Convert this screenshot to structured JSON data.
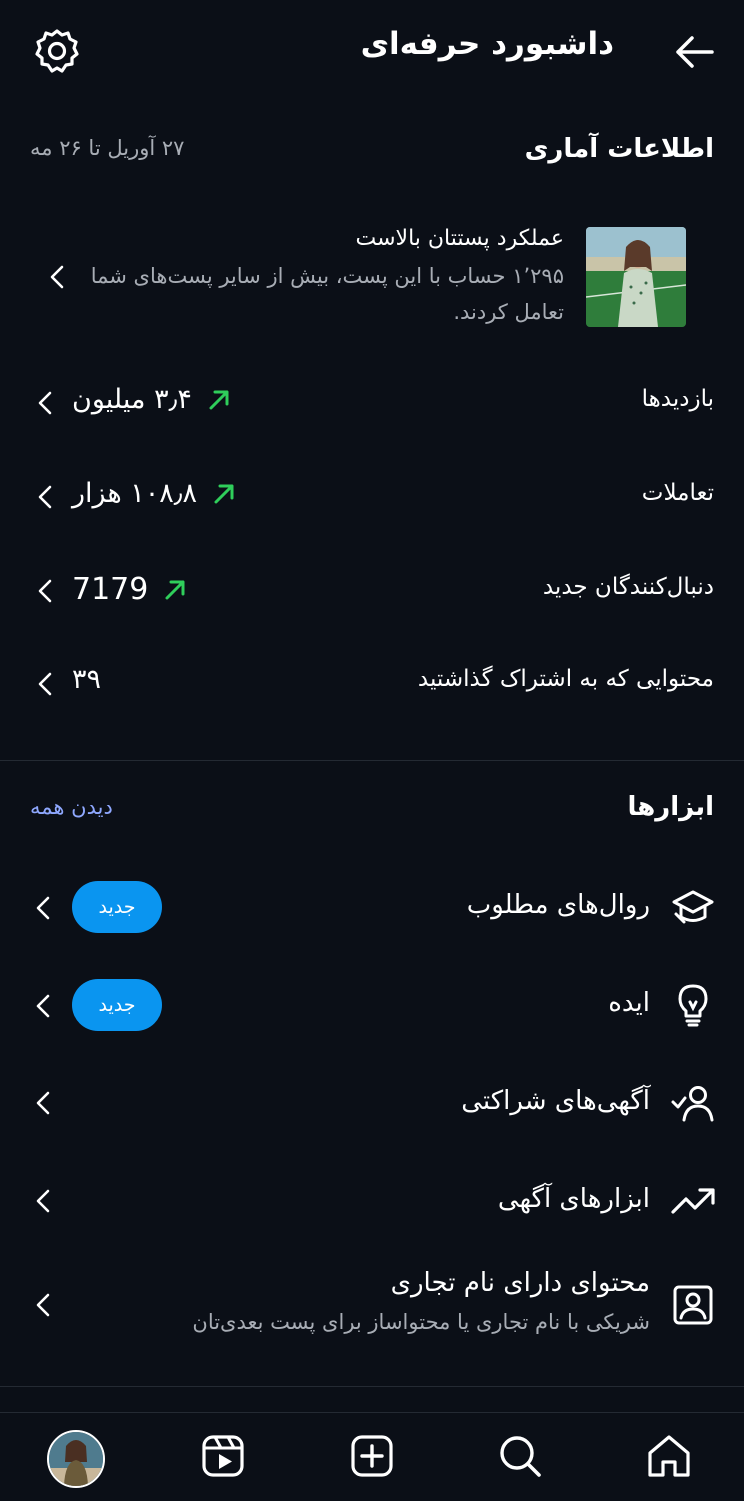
{
  "header": {
    "title": "داشبورد حرفه‌ای",
    "back_icon": "arrow-right-icon",
    "settings_icon": "gear-icon"
  },
  "stats": {
    "title": "اطلاعات آماری",
    "date_range": "۲۷ آوریل تا ۲۶ مه",
    "top_post": {
      "title": "عملکرد پستتان بالاست",
      "description": "۱٬۲۹۵ حساب با این پست، بیش از سایر پست‌های شما تعامل کردند."
    },
    "rows": [
      {
        "label": "بازدیدها",
        "value": "۳٫۴ میلیون",
        "trend": "up"
      },
      {
        "label": "تعاملات",
        "value": "۱۰۸٫۸ هزار",
        "trend": "up"
      },
      {
        "label": "دنبال‌کنندگان جدید",
        "value": "7179",
        "trend": "up"
      },
      {
        "label": "محتوایی که به اشتراک گذاشتید",
        "value": "۳۹",
        "trend": "none"
      }
    ],
    "trend_color": "#2fce5b"
  },
  "tools": {
    "title": "ابزارها",
    "see_all": "دیدن همه",
    "badge_label": "جدید",
    "items": [
      {
        "label": "روال‌های مطلوب",
        "icon": "graduation-cap-icon",
        "badge": true
      },
      {
        "label": "ایده",
        "icon": "lightbulb-icon",
        "badge": true
      },
      {
        "label": "آگهی‌های شراکتی",
        "icon": "partner-person-icon",
        "badge": false
      },
      {
        "label": "ابزارهای آگهی",
        "icon": "trending-up-icon",
        "badge": false
      },
      {
        "label": "محتوای دارای نام تجاری",
        "sub": "شریکی با نام تجاری یا محتواساز برای پست بعدی‌تان",
        "icon": "branded-content-icon",
        "badge": false
      }
    ]
  },
  "nav": {
    "items": [
      "home-icon",
      "search-icon",
      "create-icon",
      "reels-icon",
      "profile-avatar"
    ]
  },
  "colors": {
    "background": "#0b0f17",
    "accent": "#0a95f0",
    "link": "#8fa8ff",
    "muted": "#a8adb5"
  }
}
